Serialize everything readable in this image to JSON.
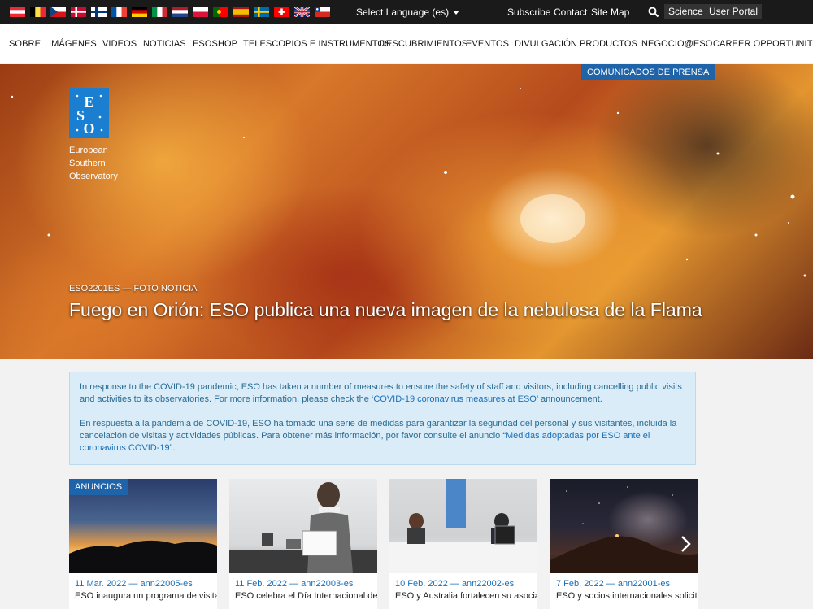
{
  "topbar": {
    "flags": [
      "austria",
      "belgium",
      "czech",
      "denmark",
      "finland",
      "france",
      "germany",
      "italy",
      "netherlands",
      "poland",
      "portugal",
      "spain",
      "sweden",
      "switzerland",
      "uk",
      "chile"
    ],
    "language_label": "Select Language (es)",
    "links": [
      "Subscribe",
      "Contact",
      "Site Map"
    ],
    "buttons": [
      "Science",
      "User Portal"
    ]
  },
  "nav": {
    "items": [
      "SOBRE",
      "IMÁGENES",
      "VIDEOS",
      "NOTICIAS",
      "ESOSHOP",
      "TELESCOPIOS E INSTRUMENTOS",
      "DESCUBRIMIENTOS",
      "EVENTOS",
      "DIVULGACIÓN",
      "PRODUCTOS",
      "NEGOCIO@ESO",
      "CAREER OPPORTUNITIES"
    ]
  },
  "hero": {
    "tag": "COMUNICADOS DE PRENSA",
    "logo_line1": "European",
    "logo_line2": "Southern",
    "logo_line3": "Observatory",
    "logo_mark": "ESO",
    "meta": "ESO2201ES — FOTO NOTICIA",
    "title": "Fuego en Orión: ESO publica una nueva imagen de la nebulosa de la Flama"
  },
  "notice": {
    "en_text": "In response to the COVID-19 pandemic, ESO has taken a number of measures to ensure the safety of staff and visitors, including cancelling public visits and activities to its observatories. For more information, please check the ‘",
    "en_link": "COVID-19 coronavirus measures at ESO",
    "en_tail": "’ announcement.",
    "es_text": "En respuesta a la pandemia de COVID-19, ESO ha tomado una serie de medidas para garantizar la seguridad del personal y sus visitantes, incluida la cancelación de visitas y actividades públicas. Para obtener más información, por favor consulte el anuncio “",
    "es_link": "Medidas adoptadas por ESO ante el coronavirus COVID-19",
    "es_tail": "”."
  },
  "cards": {
    "badge": "ANUNCIOS",
    "items": [
      {
        "meta": "11 Mar. 2022 — ann22005-es",
        "title": "ESO inaugura un programa de visitas"
      },
      {
        "meta": "11 Feb. 2022 — ann22003-es",
        "title": "ESO celebra el Día Internacional de la"
      },
      {
        "meta": "10 Feb. 2022 — ann22002-es",
        "title": "ESO y Australia fortalecen su asociac"
      },
      {
        "meta": "7 Feb. 2022 — ann22001-es",
        "title": "ESO y socios internacionales solicitan"
      }
    ]
  }
}
